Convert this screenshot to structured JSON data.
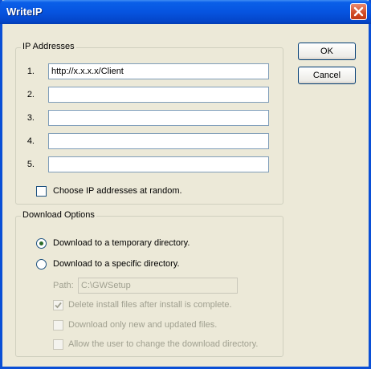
{
  "window": {
    "title": "WriteIP"
  },
  "buttons": {
    "ok": "OK",
    "cancel": "Cancel"
  },
  "ip_group": {
    "legend": "IP Addresses",
    "entries": [
      {
        "num": "1.",
        "value": "http://x.x.x.x/Client"
      },
      {
        "num": "2.",
        "value": ""
      },
      {
        "num": "3.",
        "value": ""
      },
      {
        "num": "4.",
        "value": ""
      },
      {
        "num": "5.",
        "value": ""
      }
    ],
    "random_label": "Choose IP addresses at random.",
    "random_checked": false
  },
  "download_group": {
    "legend": "Download Options",
    "temp_label": "Download to a temporary directory.",
    "temp_selected": true,
    "specific_label": "Download to a specific directory.",
    "specific_selected": false,
    "path_label": "Path:",
    "path_value": "C:\\GWSetup",
    "delete_label": "Delete install files after install is complete.",
    "delete_checked": true,
    "newonly_label": "Download only new and updated files.",
    "newonly_checked": false,
    "allowchange_label": "Allow the user to change the download directory.",
    "allowchange_checked": false
  },
  "icons": {
    "close": "close-x-icon",
    "check": "checkmark-icon",
    "radio": "radio-dot-icon"
  },
  "colors": {
    "titlebar": "#0654e0",
    "dialog_bg": "#ece9d8",
    "close_button": "#d04a24",
    "field_border": "#7f9db9",
    "disabled_text": "#a0a090"
  }
}
